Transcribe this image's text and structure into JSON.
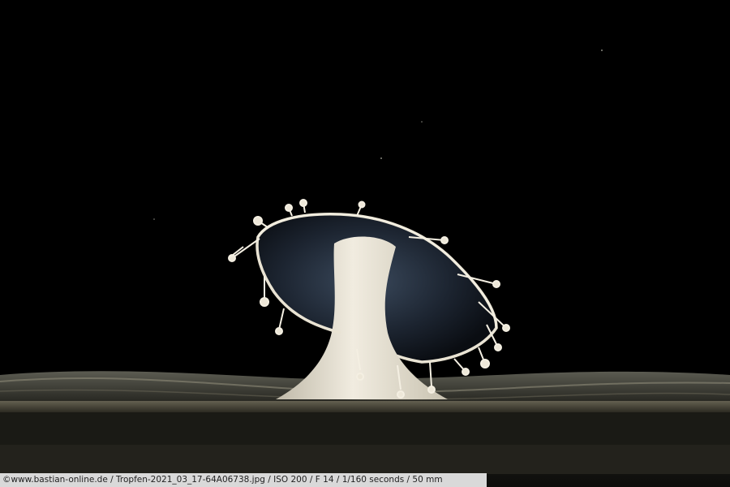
{
  "photo": {
    "subject": "milk drop splash crown over liquid surface",
    "background_color": "#000000",
    "liquid_color": "#e8e2cf"
  },
  "caption": {
    "text": "©www.bastian-online.de / Tropfen-2021_03_17-64A06738.jpg / ISO 200 / F 14 / 1/160 seconds  / 50 mm"
  }
}
